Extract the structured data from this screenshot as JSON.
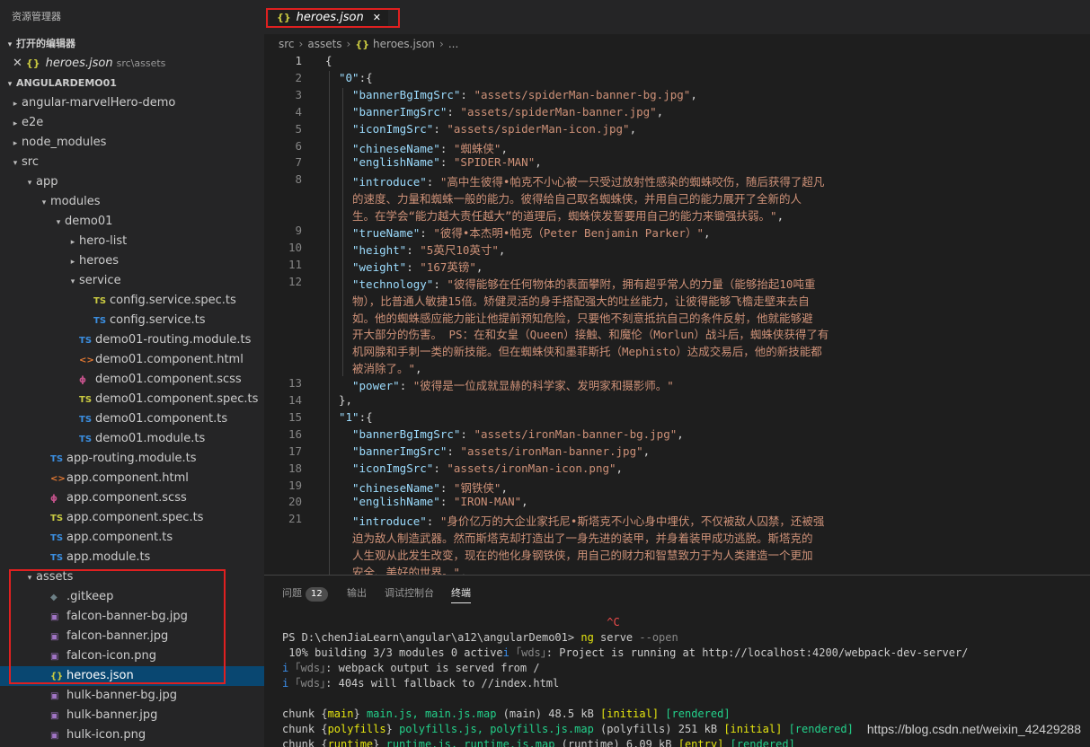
{
  "explorer": {
    "title": "资源管理器",
    "open_editors_label": "打开的编辑器",
    "open_editor": {
      "close_glyph": "✕",
      "icon": "{}",
      "name": "heroes.json",
      "path": "src\\assets"
    },
    "project_label": "ANGULARDEMO01",
    "tree": [
      {
        "label": "angular-marvelHero-demo",
        "depth": 0,
        "chevron": "▸",
        "icon": ""
      },
      {
        "label": "e2e",
        "depth": 0,
        "chevron": "▸",
        "icon": ""
      },
      {
        "label": "node_modules",
        "depth": 0,
        "chevron": "▸",
        "icon": ""
      },
      {
        "label": "src",
        "depth": 0,
        "chevron": "▾",
        "icon": ""
      },
      {
        "label": "app",
        "depth": 1,
        "chevron": "▾",
        "icon": ""
      },
      {
        "label": "modules",
        "depth": 2,
        "chevron": "▾",
        "icon": ""
      },
      {
        "label": "demo01",
        "depth": 3,
        "chevron": "▾",
        "icon": ""
      },
      {
        "label": "hero-list",
        "depth": 4,
        "chevron": "▸",
        "icon": ""
      },
      {
        "label": "heroes",
        "depth": 4,
        "chevron": "▸",
        "icon": ""
      },
      {
        "label": "service",
        "depth": 4,
        "chevron": "▾",
        "icon": ""
      },
      {
        "label": "config.service.spec.ts",
        "depth": 5,
        "chevron": "",
        "icon": "TS",
        "kind": "tss"
      },
      {
        "label": "config.service.ts",
        "depth": 5,
        "chevron": "",
        "icon": "TS",
        "kind": "ts"
      },
      {
        "label": "demo01-routing.module.ts",
        "depth": 4,
        "chevron": "",
        "icon": "TS",
        "kind": "ts"
      },
      {
        "label": "demo01.component.html",
        "depth": 4,
        "chevron": "",
        "icon": "<>",
        "kind": "html"
      },
      {
        "label": "demo01.component.scss",
        "depth": 4,
        "chevron": "",
        "icon": "ϕ",
        "kind": "scss"
      },
      {
        "label": "demo01.component.spec.ts",
        "depth": 4,
        "chevron": "",
        "icon": "TS",
        "kind": "tss"
      },
      {
        "label": "demo01.component.ts",
        "depth": 4,
        "chevron": "",
        "icon": "TS",
        "kind": "ts"
      },
      {
        "label": "demo01.module.ts",
        "depth": 4,
        "chevron": "",
        "icon": "TS",
        "kind": "ts"
      },
      {
        "label": "app-routing.module.ts",
        "depth": 2,
        "chevron": "",
        "icon": "TS",
        "kind": "ts"
      },
      {
        "label": "app.component.html",
        "depth": 2,
        "chevron": "",
        "icon": "<>",
        "kind": "html"
      },
      {
        "label": "app.component.scss",
        "depth": 2,
        "chevron": "",
        "icon": "ϕ",
        "kind": "scss"
      },
      {
        "label": "app.component.spec.ts",
        "depth": 2,
        "chevron": "",
        "icon": "TS",
        "kind": "tss"
      },
      {
        "label": "app.component.ts",
        "depth": 2,
        "chevron": "",
        "icon": "TS",
        "kind": "ts"
      },
      {
        "label": "app.module.ts",
        "depth": 2,
        "chevron": "",
        "icon": "TS",
        "kind": "ts"
      },
      {
        "label": "assets",
        "depth": 1,
        "chevron": "▾",
        "icon": ""
      },
      {
        "label": ".gitkeep",
        "depth": 2,
        "chevron": "",
        "icon": "◆",
        "kind": "git"
      },
      {
        "label": "falcon-banner-bg.jpg",
        "depth": 2,
        "chevron": "",
        "icon": "▣",
        "kind": "img"
      },
      {
        "label": "falcon-banner.jpg",
        "depth": 2,
        "chevron": "",
        "icon": "▣",
        "kind": "img"
      },
      {
        "label": "falcon-icon.png",
        "depth": 2,
        "chevron": "",
        "icon": "▣",
        "kind": "img"
      },
      {
        "label": "heroes.json",
        "depth": 2,
        "chevron": "",
        "icon": "{}",
        "kind": "json",
        "selected": true
      },
      {
        "label": "hulk-banner-bg.jpg",
        "depth": 2,
        "chevron": "",
        "icon": "▣",
        "kind": "img"
      },
      {
        "label": "hulk-banner.jpg",
        "depth": 2,
        "chevron": "",
        "icon": "▣",
        "kind": "img"
      },
      {
        "label": "hulk-icon.png",
        "depth": 2,
        "chevron": "",
        "icon": "▣",
        "kind": "img"
      }
    ]
  },
  "editor": {
    "tab": {
      "icon": "{}",
      "name": "heroes.json",
      "close_glyph": "✕"
    },
    "breadcrumb": [
      "src",
      "assets",
      "heroes.json",
      "..."
    ],
    "breadcrumb_sep": "›",
    "lines": [
      {
        "n": "1",
        "indent": 0,
        "tokens": [
          {
            "t": "{",
            "c": "p"
          }
        ],
        "cur": true
      },
      {
        "n": "2",
        "indent": 1,
        "tokens": [
          {
            "t": "\"0\"",
            "c": "k"
          },
          {
            "t": ":{",
            "c": "p"
          }
        ]
      },
      {
        "n": "3",
        "indent": 2,
        "tokens": [
          {
            "t": "\"bannerBgImgSrc\"",
            "c": "k"
          },
          {
            "t": ": ",
            "c": "p"
          },
          {
            "t": "\"assets/spiderMan-banner-bg.jpg\"",
            "c": "s"
          },
          {
            "t": ",",
            "c": "p"
          }
        ]
      },
      {
        "n": "4",
        "indent": 2,
        "tokens": [
          {
            "t": "\"bannerImgSrc\"",
            "c": "k"
          },
          {
            "t": ": ",
            "c": "p"
          },
          {
            "t": "\"assets/spiderMan-banner.jpg\"",
            "c": "s"
          },
          {
            "t": ",",
            "c": "p"
          }
        ]
      },
      {
        "n": "5",
        "indent": 2,
        "tokens": [
          {
            "t": "\"iconImgSrc\"",
            "c": "k"
          },
          {
            "t": ": ",
            "c": "p"
          },
          {
            "t": "\"assets/spiderMan-icon.jpg\"",
            "c": "s"
          },
          {
            "t": ",",
            "c": "p"
          }
        ]
      },
      {
        "n": "6",
        "indent": 2,
        "tokens": [
          {
            "t": "\"chineseName\"",
            "c": "k"
          },
          {
            "t": ": ",
            "c": "p"
          },
          {
            "t": "\"蜘蛛侠\"",
            "c": "s"
          },
          {
            "t": ",",
            "c": "p"
          }
        ]
      },
      {
        "n": "7",
        "indent": 2,
        "tokens": [
          {
            "t": "\"englishName\"",
            "c": "k"
          },
          {
            "t": ": ",
            "c": "p"
          },
          {
            "t": "\"SPIDER-MAN\"",
            "c": "s"
          },
          {
            "t": ",",
            "c": "p"
          }
        ]
      },
      {
        "n": "8",
        "indent": 2,
        "tokens": [
          {
            "t": "\"introduce\"",
            "c": "k"
          },
          {
            "t": ": ",
            "c": "p"
          },
          {
            "t": "\"高中生彼得•帕克不小心被一只受过放射性感染的蜘蛛咬伤，随后获得了超凡",
            "c": "s"
          }
        ]
      },
      {
        "n": "",
        "indent": 2,
        "tokens": [
          {
            "t": "的速度、力量和蜘蛛一般的能力。彼得给自己取名蜘蛛侠，并用自己的能力展开了全新的人",
            "c": "s"
          }
        ]
      },
      {
        "n": "",
        "indent": 2,
        "tokens": [
          {
            "t": "生。在学会“能力越大责任越大”的道理后，蜘蛛侠发誓要用自己的能力来锄强扶弱。\"",
            "c": "s"
          },
          {
            "t": ",",
            "c": "p"
          }
        ]
      },
      {
        "n": "9",
        "indent": 2,
        "tokens": [
          {
            "t": "\"trueName\"",
            "c": "k"
          },
          {
            "t": ": ",
            "c": "p"
          },
          {
            "t": "\"彼得•本杰明•帕克（Peter Benjamin Parker）\"",
            "c": "s"
          },
          {
            "t": ",",
            "c": "p"
          }
        ]
      },
      {
        "n": "10",
        "indent": 2,
        "tokens": [
          {
            "t": "\"height\"",
            "c": "k"
          },
          {
            "t": ": ",
            "c": "p"
          },
          {
            "t": "\"5英尺10英寸\"",
            "c": "s"
          },
          {
            "t": ",",
            "c": "p"
          }
        ]
      },
      {
        "n": "11",
        "indent": 2,
        "tokens": [
          {
            "t": "\"weight\"",
            "c": "k"
          },
          {
            "t": ": ",
            "c": "p"
          },
          {
            "t": "\"167英镑\"",
            "c": "s"
          },
          {
            "t": ",",
            "c": "p"
          }
        ]
      },
      {
        "n": "12",
        "indent": 2,
        "tokens": [
          {
            "t": "\"technology\"",
            "c": "k"
          },
          {
            "t": ": ",
            "c": "p"
          },
          {
            "t": "\"彼得能够在任何物体的表面攀附，拥有超乎常人的力量（能够抬起10吨重",
            "c": "s"
          }
        ]
      },
      {
        "n": "",
        "indent": 2,
        "tokens": [
          {
            "t": "物），比普通人敏捷15倍。矫健灵活的身手搭配强大的吐丝能力，让彼得能够飞檐走壁来去自",
            "c": "s"
          }
        ]
      },
      {
        "n": "",
        "indent": 2,
        "tokens": [
          {
            "t": "如。他的蜘蛛感应能力能让他提前预知危险，只要他不刻意抵抗自己的条件反射，他就能够避",
            "c": "s"
          }
        ]
      },
      {
        "n": "",
        "indent": 2,
        "tokens": [
          {
            "t": "开大部分的伤害。 PS：在和女皇（Queen）接触、和魔伦（Morlun）战斗后，蜘蛛侠获得了有",
            "c": "s"
          }
        ]
      },
      {
        "n": "",
        "indent": 2,
        "tokens": [
          {
            "t": "机网腺和手刺一类的新技能。但在蜘蛛侠和墨菲斯托（Mephisto）达成交易后，他的新技能都",
            "c": "s"
          }
        ]
      },
      {
        "n": "",
        "indent": 2,
        "tokens": [
          {
            "t": "被消除了。\"",
            "c": "s"
          },
          {
            "t": ",",
            "c": "p"
          }
        ]
      },
      {
        "n": "13",
        "indent": 2,
        "tokens": [
          {
            "t": "\"power\"",
            "c": "k"
          },
          {
            "t": ": ",
            "c": "p"
          },
          {
            "t": "\"彼得是一位成就显赫的科学家、发明家和摄影师。\"",
            "c": "s"
          }
        ]
      },
      {
        "n": "14",
        "indent": 1,
        "tokens": [
          {
            "t": "},",
            "c": "p"
          }
        ]
      },
      {
        "n": "15",
        "indent": 1,
        "tokens": [
          {
            "t": "\"1\"",
            "c": "k"
          },
          {
            "t": ":{",
            "c": "p"
          }
        ]
      },
      {
        "n": "16",
        "indent": 2,
        "tokens": [
          {
            "t": "\"bannerBgImgSrc\"",
            "c": "k"
          },
          {
            "t": ": ",
            "c": "p"
          },
          {
            "t": "\"assets/ironMan-banner-bg.jpg\"",
            "c": "s"
          },
          {
            "t": ",",
            "c": "p"
          }
        ]
      },
      {
        "n": "17",
        "indent": 2,
        "tokens": [
          {
            "t": "\"bannerImgSrc\"",
            "c": "k"
          },
          {
            "t": ": ",
            "c": "p"
          },
          {
            "t": "\"assets/ironMan-banner.jpg\"",
            "c": "s"
          },
          {
            "t": ",",
            "c": "p"
          }
        ]
      },
      {
        "n": "18",
        "indent": 2,
        "tokens": [
          {
            "t": "\"iconImgSrc\"",
            "c": "k"
          },
          {
            "t": ": ",
            "c": "p"
          },
          {
            "t": "\"assets/ironMan-icon.png\"",
            "c": "s"
          },
          {
            "t": ",",
            "c": "p"
          }
        ]
      },
      {
        "n": "19",
        "indent": 2,
        "tokens": [
          {
            "t": "\"chineseName\"",
            "c": "k"
          },
          {
            "t": ": ",
            "c": "p"
          },
          {
            "t": "\"钢铁侠\"",
            "c": "s"
          },
          {
            "t": ",",
            "c": "p"
          }
        ]
      },
      {
        "n": "20",
        "indent": 2,
        "tokens": [
          {
            "t": "\"englishName\"",
            "c": "k"
          },
          {
            "t": ": ",
            "c": "p"
          },
          {
            "t": "\"IRON-MAN\"",
            "c": "s"
          },
          {
            "t": ",",
            "c": "p"
          }
        ]
      },
      {
        "n": "21",
        "indent": 2,
        "tokens": [
          {
            "t": "\"introduce\"",
            "c": "k"
          },
          {
            "t": ": ",
            "c": "p"
          },
          {
            "t": "\"身价亿万的大企业家托尼•斯塔克不小心身中埋伏，不仅被敌人囚禁，还被强",
            "c": "s"
          }
        ]
      },
      {
        "n": "",
        "indent": 2,
        "tokens": [
          {
            "t": "迫为敌人制造武器。然而斯塔克却打造出了一身先进的装甲，并身着装甲成功逃脱。斯塔克的",
            "c": "s"
          }
        ]
      },
      {
        "n": "",
        "indent": 2,
        "tokens": [
          {
            "t": "人生观从此发生改变，现在的他化身钢铁侠，用自己的财力和智慧致力于为人类建造一个更加",
            "c": "s"
          }
        ]
      },
      {
        "n": "",
        "indent": 2,
        "tokens": [
          {
            "t": "安全、美好的世界。\"",
            "c": "s"
          },
          {
            "t": ",",
            "c": "p"
          }
        ]
      }
    ]
  },
  "panel": {
    "tabs": [
      {
        "label": "问题",
        "badge": "12"
      },
      {
        "label": "输出"
      },
      {
        "label": "调试控制台"
      },
      {
        "label": "终端",
        "active": true
      }
    ],
    "terminal": [
      [
        {
          "t": "                                                  ^C",
          "c": "tr"
        }
      ],
      [
        {
          "t": "PS D:\\chenJiaLearn\\angular\\a12\\angularDemo01> "
        },
        {
          "t": "ng",
          "c": "ty"
        },
        {
          "t": " serve "
        },
        {
          "t": "--open",
          "c": "tgr"
        }
      ],
      [
        {
          "t": " 10% building 3/3 modules 0 active"
        },
        {
          "t": "i",
          "c": "tc"
        },
        {
          "t": " "
        },
        {
          "t": "｢wds｣",
          "c": "tgr"
        },
        {
          "t": ": Project is running at http://localhost:4200/webpack-dev-server/"
        }
      ],
      [
        {
          "t": "i",
          "c": "tc"
        },
        {
          "t": " "
        },
        {
          "t": "｢wds｣",
          "c": "tgr"
        },
        {
          "t": ": webpack output is served from /"
        }
      ],
      [
        {
          "t": "i",
          "c": "tc"
        },
        {
          "t": " "
        },
        {
          "t": "｢wds｣",
          "c": "tgr"
        },
        {
          "t": ": 404s will fallback to //index.html"
        }
      ],
      [
        {
          "t": " "
        }
      ],
      [
        {
          "t": "chunk {"
        },
        {
          "t": "main",
          "c": "ty"
        },
        {
          "t": "} "
        },
        {
          "t": "main.js, main.js.map",
          "c": "tg"
        },
        {
          "t": " (main) 48.5 kB "
        },
        {
          "t": "[initial]",
          "c": "ty"
        },
        {
          "t": " "
        },
        {
          "t": "[rendered]",
          "c": "tg"
        }
      ],
      [
        {
          "t": "chunk {"
        },
        {
          "t": "polyfills",
          "c": "ty"
        },
        {
          "t": "} "
        },
        {
          "t": "polyfills.js, polyfills.js.map",
          "c": "tg"
        },
        {
          "t": " (polyfills) 251 kB "
        },
        {
          "t": "[initial]",
          "c": "ty"
        },
        {
          "t": " "
        },
        {
          "t": "[rendered]",
          "c": "tg"
        }
      ],
      [
        {
          "t": "chunk {"
        },
        {
          "t": "runtime",
          "c": "ty"
        },
        {
          "t": "} "
        },
        {
          "t": "runtime.js, runtime.js.map",
          "c": "tg"
        },
        {
          "t": " (runtime) 6.09 kB "
        },
        {
          "t": "[entry]",
          "c": "ty"
        },
        {
          "t": " "
        },
        {
          "t": "[rendered]",
          "c": "tg"
        }
      ]
    ],
    "watermark": "https://blog.csdn.net/weixin_42429288"
  }
}
